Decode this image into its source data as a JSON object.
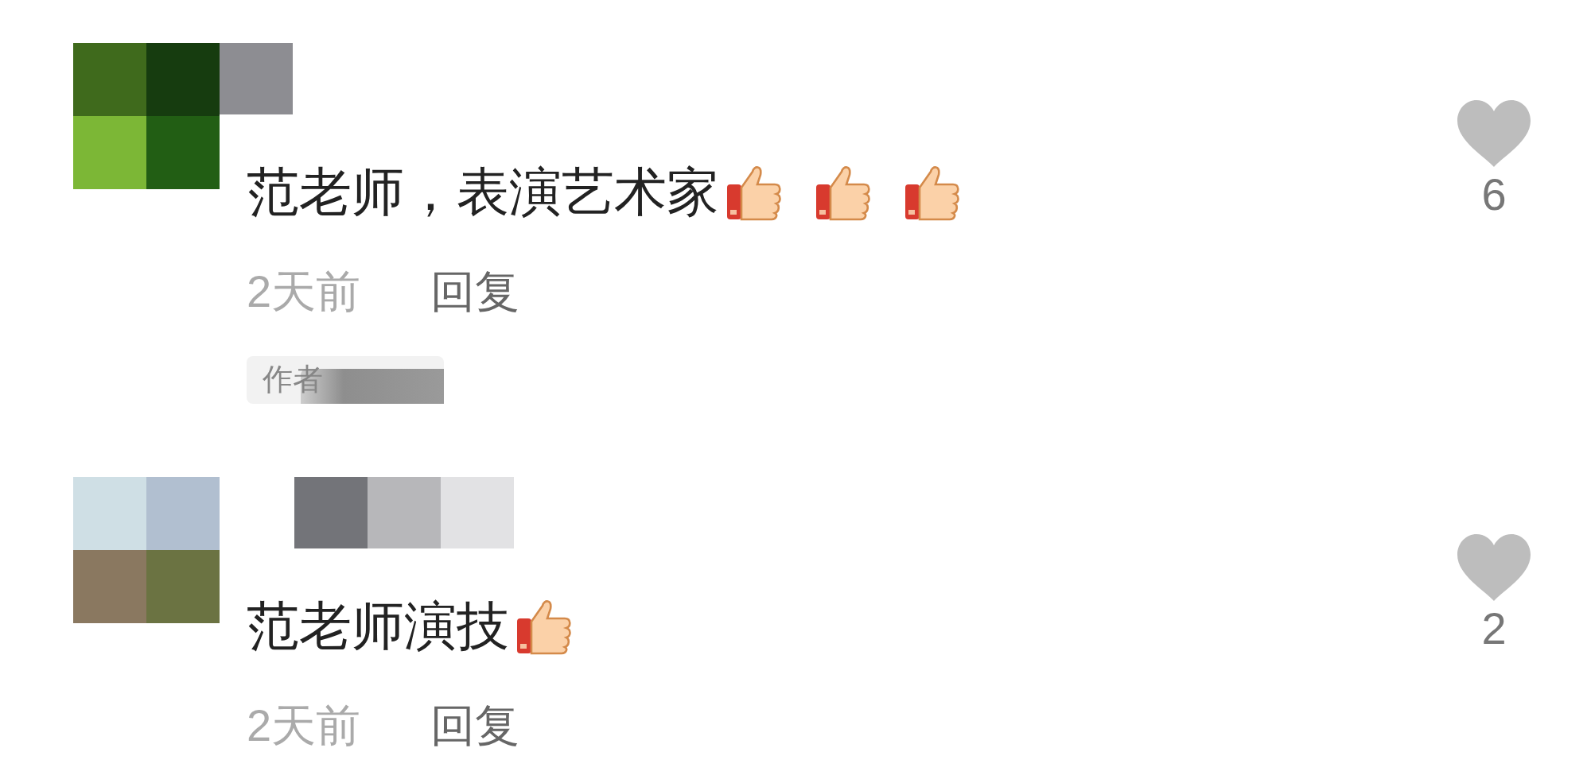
{
  "comments": [
    {
      "text": "范老师，表演艺术家",
      "emojis": [
        {
          "kind": "thumbs_up"
        },
        {
          "kind": "thumbs_up"
        },
        {
          "kind": "thumbs_up"
        }
      ],
      "time": "2天前",
      "reply": "回复",
      "badge": "作者",
      "likes": "6"
    },
    {
      "text": "范老师演技",
      "emojis": [
        {
          "kind": "thumbs_up"
        }
      ],
      "time": "2天前",
      "reply": "回复",
      "likes": "2"
    }
  ]
}
